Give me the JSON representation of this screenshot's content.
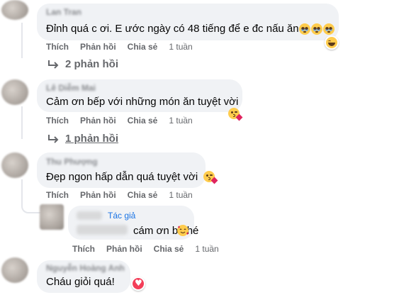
{
  "colors": {
    "bubble": "#f0f2f5",
    "meta": "#65676b",
    "text": "#050505",
    "author_tag": "#1b74e4",
    "thread_line": "#e4e6eb"
  },
  "comments": [
    {
      "author": "Lan Tran",
      "text": "Đỉnh quá c ơi. E ước ngày có 48 tiếng để e đc nấu ăn",
      "emojis": [
        "crying-face-emoji",
        "crying-face-emoji",
        "crying-face-emoji"
      ],
      "reaction": "haha-reaction-icon",
      "actions": {
        "like": "Thích",
        "reply": "Phản hồi",
        "share": "Chia sẻ",
        "time": "1 tuần"
      },
      "replies_label": "2 phản hồi"
    },
    {
      "author": "Lê Diễm Mai",
      "text": "Cảm ơn bếp với những món ăn tuyệt vời",
      "emojis": [
        "face-blowing-kiss-emoji"
      ],
      "actions": {
        "like": "Thích",
        "reply": "Phản hồi",
        "share": "Chia sẻ",
        "time": "1 tuần"
      },
      "replies_label": "1 phản hồi"
    },
    {
      "author": "Thu Phượng",
      "text": "Đẹp ngon hấp dẫn quá tuyệt vời",
      "emojis": [
        "face-blowing-kiss-emoji"
      ],
      "actions": {
        "like": "Thích",
        "reply": "Phản hồi",
        "share": "Chia sẻ",
        "time": "1 tuần"
      },
      "reply": {
        "author_tag": "Tác giả",
        "text": "cám ơn b nhé",
        "emojis": [
          "smiling-face-with-hearts-emoji"
        ],
        "actions": {
          "like": "Thích",
          "reply": "Phản hồi",
          "share": "Chia sẻ",
          "time": "1 tuần"
        }
      }
    },
    {
      "author": "Nguyễn Hoàng Anh",
      "text": "Cháu giỏi quá!",
      "reaction": "love-reaction-icon"
    }
  ]
}
